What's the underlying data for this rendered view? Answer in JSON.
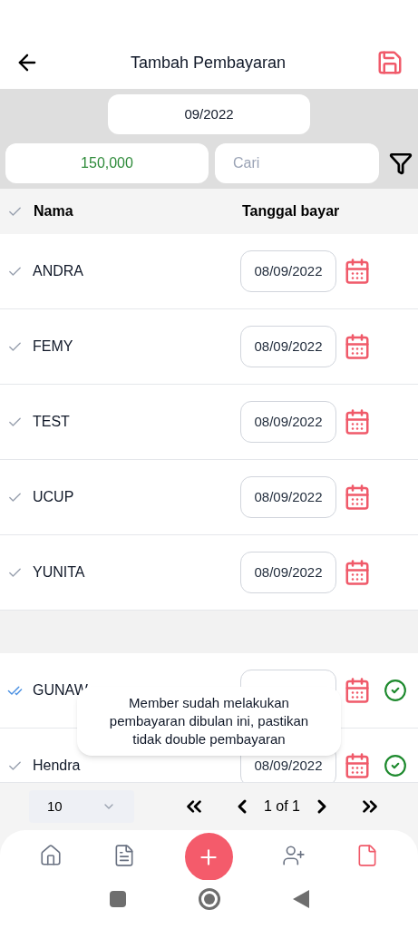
{
  "header": {
    "title": "Tambah Pembayaran"
  },
  "filters": {
    "month": "09/2022",
    "amount": "150,000",
    "search": {
      "placeholder": "Cari"
    }
  },
  "table": {
    "columns": [
      "Nama",
      "Tanggal bayar"
    ],
    "sections": [
      {
        "rows": [
          {
            "name": "ANDRA",
            "date": "08/09/2022",
            "checked": false,
            "paid": false
          },
          {
            "name": "FEMY",
            "date": "08/09/2022",
            "checked": false,
            "paid": false
          },
          {
            "name": "TEST",
            "date": "08/09/2022",
            "checked": false,
            "paid": false
          },
          {
            "name": "UCUP",
            "date": "08/09/2022",
            "checked": false,
            "paid": false
          },
          {
            "name": "YUNITA",
            "date": "08/09/2022",
            "checked": false,
            "paid": false
          }
        ]
      },
      {
        "rows": [
          {
            "name": "GUNAW",
            "checked": true,
            "paid": true
          },
          {
            "name": "Hendra",
            "date": "08/09/2022",
            "checked": false,
            "paid": true
          }
        ]
      }
    ]
  },
  "toast": "Member sudah melakukan pembayaran dibulan ini, pastikan tidak double pembayaran",
  "pagination": {
    "page_size": "10",
    "page": "1 of 1"
  },
  "nav_items": [
    {
      "selected": false
    },
    {
      "selected": false
    },
    {
      "selected": false
    },
    {
      "selected": true
    }
  ]
}
